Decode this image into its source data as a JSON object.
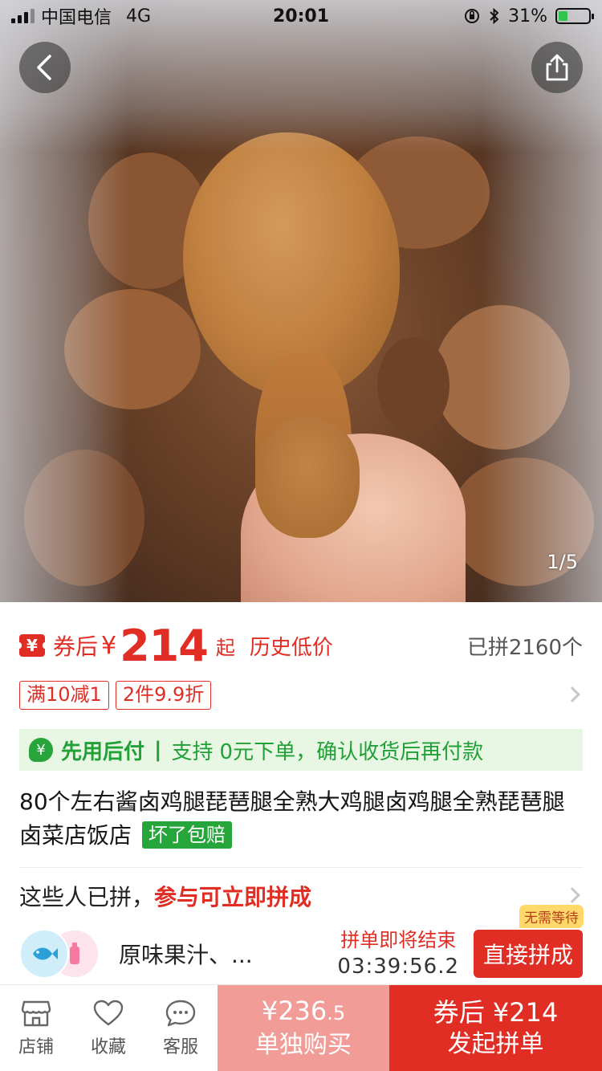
{
  "status_bar": {
    "carrier": "中国电信",
    "network": "4G",
    "time": "20:01",
    "battery": "31%"
  },
  "gallery": {
    "counter": "1/5"
  },
  "price": {
    "coupon_icon": "¥",
    "label": "券后",
    "currency": "¥",
    "amount": "214",
    "suffix": "起",
    "tag": "历史低价",
    "sold": "已拼2160个"
  },
  "promos": [
    "满10减1",
    "2件9.9折"
  ],
  "pay_after": {
    "icon": "¥",
    "title": "先用后付",
    "separator": "|",
    "support": "支持",
    "zero": "0元下单，",
    "rest": "确认收货后再付款"
  },
  "product": {
    "title": "80个左右酱卤鸡腿琵琶腿全熟大鸡腿卤鸡腿全熟琵琶腿卤菜店饭店",
    "guarantee": "坏了包赔"
  },
  "group": {
    "header_text": "这些人已拼，",
    "header_accent": "参与可立即拼成",
    "member_name": "原味果汁、...",
    "timer_label": "拼单即将结束",
    "timer_value": "03:39:56.2",
    "join_label": "直接拼成",
    "join_badge": "无需等待"
  },
  "bottom_bar": {
    "store": "店铺",
    "favorite": "收藏",
    "service": "客服",
    "solo_price_main": "¥236",
    "solo_price_decimal": ".5",
    "solo_label": "单独购买",
    "group_price": "券后 ¥214",
    "group_label": "发起拼单"
  },
  "colors": {
    "accent": "#e02e24",
    "green": "#25a53a",
    "solo_button": "#f29c98"
  }
}
